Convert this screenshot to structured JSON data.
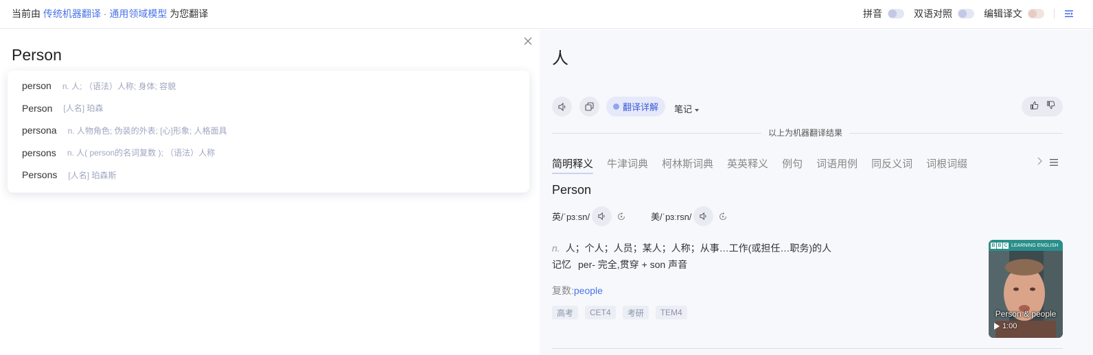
{
  "topbar": {
    "prefix": "当前由",
    "engine": "传统机器翻译",
    "dot": "·",
    "model": "通用领域模型",
    "suffix": "为您翻译",
    "toggle_pinyin": "拼音",
    "toggle_bilingual": "双语对照",
    "toggle_edit": "编辑译文"
  },
  "source": {
    "text": "Person"
  },
  "suggestions": [
    {
      "word": "person",
      "def": "n. 人; （语法）人称; 身体; 容貌"
    },
    {
      "word": "Person",
      "def": "[人名] 珀森"
    },
    {
      "word": "persona",
      "def": "n. 人物角色; 伪装的外表; [心]形象; 人格面具"
    },
    {
      "word": "persons",
      "def": "n. 人( person的名词复数 ); （语法）人称"
    },
    {
      "word": "Persons",
      "def": "[人名] 珀森斯"
    }
  ],
  "result": {
    "translation": "人",
    "detail_button": "翻译详解",
    "note_button": "笔记",
    "mt_notice": "以上为机器翻译结果"
  },
  "tabs": [
    "简明释义",
    "牛津词典",
    "柯林斯词典",
    "英英释义",
    "例句",
    "词语用例",
    "同反义词",
    "词根词缀"
  ],
  "dict": {
    "word": "Person",
    "uk_label": "英/ˈpɜːsn/",
    "us_label": "美/ˈpɜːrsn/",
    "pos": "n.",
    "meaning": "人；个人；人员；某人；人称；从事…工作(或担任…职务)的人",
    "mem_key": "记忆",
    "mem_text": "per- 完全,贯穿 + son 声音",
    "plural_label": "复数:",
    "plural_value": "people",
    "tags": [
      "高考",
      "CET4",
      "考研",
      "TEM4"
    ]
  },
  "video": {
    "brand_text": "LEARNING ENGLISH",
    "brand_letters": [
      "B",
      "B",
      "C"
    ],
    "caption": "Person & people",
    "duration": "1:00"
  },
  "colors": {
    "accent": "#4a74e8",
    "detail_text": "#3a5bd9",
    "panel_bg": "#f7f8fb",
    "video_brand": "#2a8f8b"
  }
}
